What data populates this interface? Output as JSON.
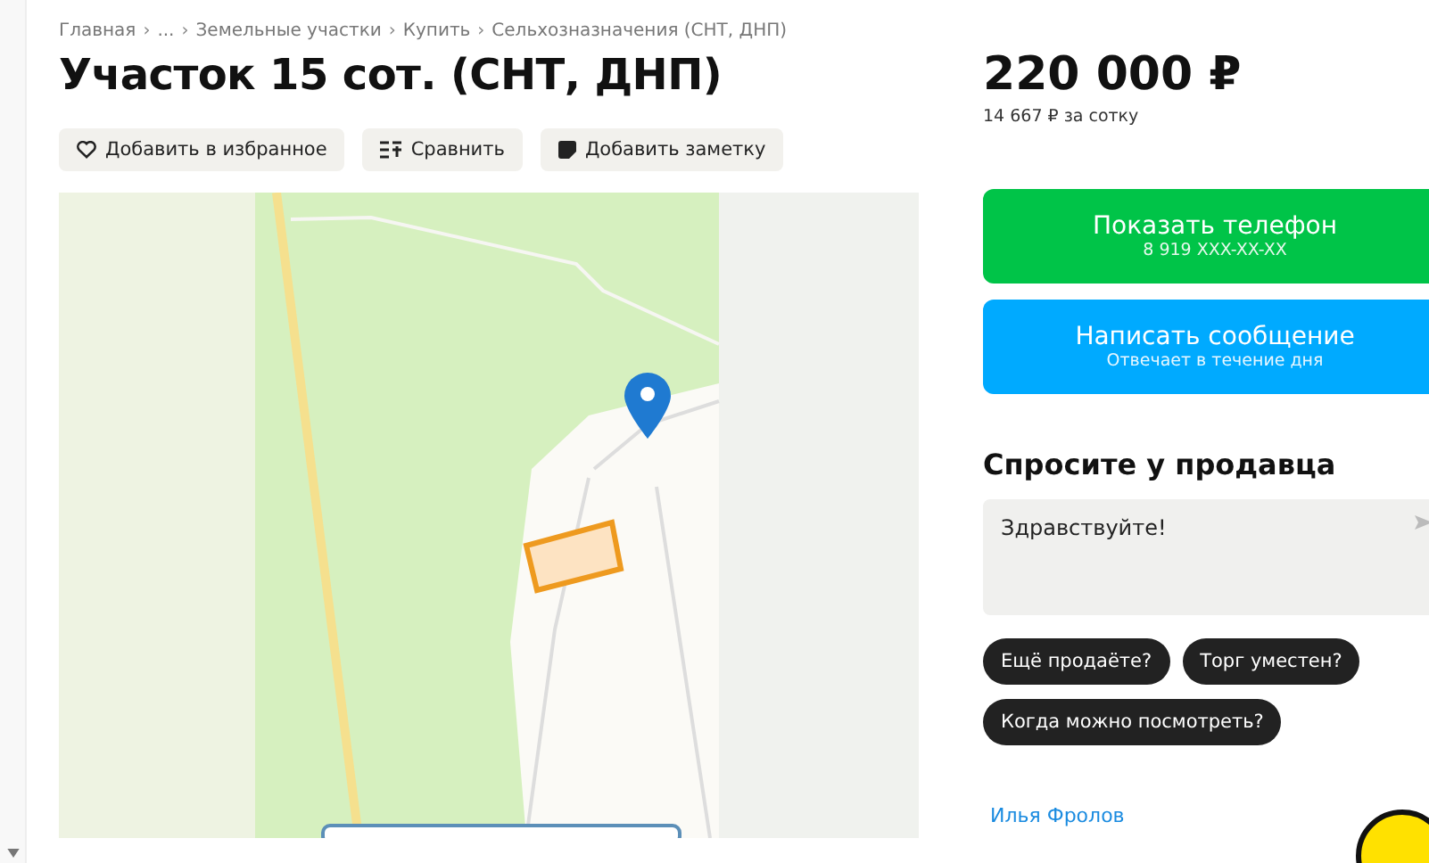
{
  "breadcrumbs": {
    "separator": "›",
    "items": [
      "Главная",
      "...",
      "Земельные участки",
      "Купить",
      "Сельхозназначения (СНТ, ДНП)"
    ]
  },
  "title": "Участок 15 сот. (СНТ, ДНП)",
  "actions": [
    {
      "kind": "favorite",
      "label": "Добавить в избранное"
    },
    {
      "kind": "compare",
      "label": "Сравнить"
    },
    {
      "kind": "note",
      "label": "Добавить заметку"
    }
  ],
  "price": {
    "value": "220 000 ₽",
    "per_unit": "14 667 ₽ за сотку"
  },
  "contact_buttons": [
    {
      "kind": "phone",
      "label": "Показать телефон",
      "sublabel": "8 919 XXX-XX-XX"
    },
    {
      "kind": "message",
      "label": "Написать сообщение",
      "sublabel": "Отвечает в течение дня"
    }
  ],
  "ask_seller": {
    "heading": "Спросите у продавца",
    "message": "Здравствуйте!",
    "quick_questions": [
      "Ещё продаёте?",
      "Торг уместен?",
      "Когда можно посмотреть?"
    ]
  },
  "seller": {
    "name": "Илья Фролов"
  }
}
